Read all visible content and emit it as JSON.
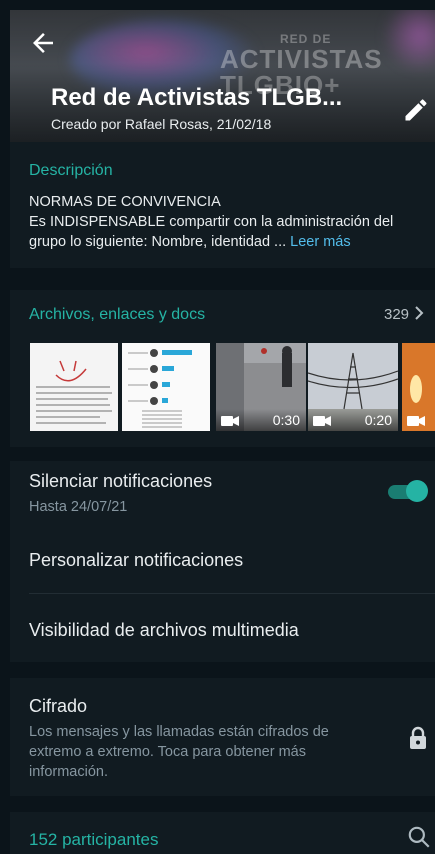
{
  "header": {
    "title": "Red de Activistas TLGB...",
    "subtitle": "Creado por Rafael Rosas, 21/02/18",
    "back_icon": "arrow-left-icon",
    "edit_icon": "pencil-icon"
  },
  "description": {
    "heading": "Descripción",
    "line1": "NORMAS DE CONVIVENCIA",
    "line2": "Es INDISPENSABLE compartir con la administración del grupo lo siguiente: Nombre, identidad ...",
    "read_more": "Leer más"
  },
  "media": {
    "heading": "Archivos, enlaces y docs",
    "count": "329",
    "items": [
      {
        "type": "document"
      },
      {
        "type": "document"
      },
      {
        "type": "video",
        "duration": "0:30"
      },
      {
        "type": "video",
        "duration": "0:20"
      },
      {
        "type": "video"
      }
    ]
  },
  "settings": {
    "mute_title": "Silenciar notificaciones",
    "mute_sub": "Hasta 24/07/21",
    "mute_on": true,
    "custom_notifications": "Personalizar notificaciones",
    "media_visibility": "Visibilidad de archivos multimedia"
  },
  "encryption": {
    "title": "Cifrado",
    "text": "Los mensajes y las llamadas están cifrados de extremo a extremo. Toca para obtener más información."
  },
  "participants": {
    "heading": "152 participantes"
  },
  "colors": {
    "accent": "#25b3a4",
    "link": "#53bdeb",
    "background": "#111b21",
    "separator": "#0b141a"
  }
}
